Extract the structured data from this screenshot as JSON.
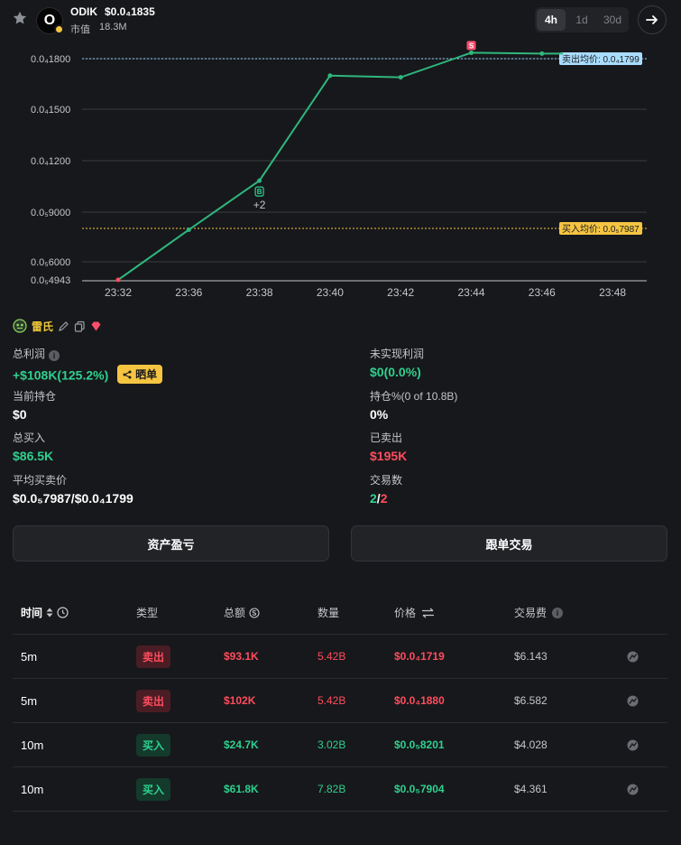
{
  "header": {
    "token_name": "ODIK",
    "token_price": "$0.0₄1835",
    "avatar_letter": "O",
    "mcap_label": "市值",
    "mcap_value": "18.3M",
    "ranges": [
      "4h",
      "1d",
      "30d"
    ],
    "active_range": "4h"
  },
  "chart_data": {
    "type": "line",
    "x": [
      "23:32",
      "23:36",
      "23:38",
      "23:40",
      "23:42",
      "23:44",
      "23:46",
      "23:48"
    ],
    "y_ticks": [
      "0.0₄1800",
      "0.0₄1500",
      "0.0₄1200",
      "0.0₅9000",
      "0.0₅6000",
      "0.0₅4943"
    ],
    "series": [
      {
        "points": [
          [
            0,
            4.943e-05
          ],
          [
            1,
            7.9e-05
          ],
          [
            2.0,
            0.000108
          ],
          [
            3.0,
            0.00017
          ],
          [
            4.0,
            0.000169
          ],
          [
            5.0,
            0.0001835
          ],
          [
            6.0,
            0.000183
          ],
          [
            6.3,
            0.000183
          ]
        ]
      }
    ],
    "sell_avg_label": "卖出均价: 0.0₄1799",
    "buy_avg_label": "买入均价: 0.0₅7987",
    "buy_marker": "B",
    "buy_marker_count": "+2",
    "sell_marker": "S",
    "accent_color": "#2fb67e"
  },
  "trader": {
    "name": "雷氏"
  },
  "stats": {
    "total_profit_label": "总利润",
    "total_profit_value": "+$108K(125.2%)",
    "share_label": "晒单",
    "unrealized_label": "未实现利润",
    "unrealized_value": "$0(0.0%)",
    "holding_label": "当前持仓",
    "holding_value": "$0",
    "holding_pct_label": "持仓%(0 of 10.8B)",
    "holding_pct_value": "0%",
    "total_buy_label": "总买入",
    "total_buy_value": "$86.5K",
    "sold_label": "已卖出",
    "sold_value": "$195K",
    "avg_price_label": "平均买卖价",
    "avg_price_value": "$0.0₅7987/$0.0₄1799",
    "trades_label": "交易数",
    "trades_buy": "2",
    "trades_sep": "/",
    "trades_sell": "2"
  },
  "buttons": {
    "asset_pnl": "资产盈亏",
    "copy_trade": "跟单交易"
  },
  "table": {
    "headers": {
      "time": "时间",
      "type": "类型",
      "total": "总额",
      "qty": "数量",
      "price": "价格",
      "fee": "交易费"
    },
    "rows": [
      {
        "time": "5m",
        "type": "卖出",
        "side": "sell",
        "total": "$93.1K",
        "qty": "5.42B",
        "price": "$0.0₄1719",
        "fee": "$6.143"
      },
      {
        "time": "5m",
        "type": "卖出",
        "side": "sell",
        "total": "$102K",
        "qty": "5.42B",
        "price": "$0.0₄1880",
        "fee": "$6.582"
      },
      {
        "time": "10m",
        "type": "买入",
        "side": "buy",
        "total": "$24.7K",
        "qty": "3.02B",
        "price": "$0.0₅8201",
        "fee": "$4.028"
      },
      {
        "time": "10m",
        "type": "买入",
        "side": "buy",
        "total": "$61.8K",
        "qty": "7.82B",
        "price": "$0.0₅7904",
        "fee": "$4.361"
      }
    ]
  }
}
